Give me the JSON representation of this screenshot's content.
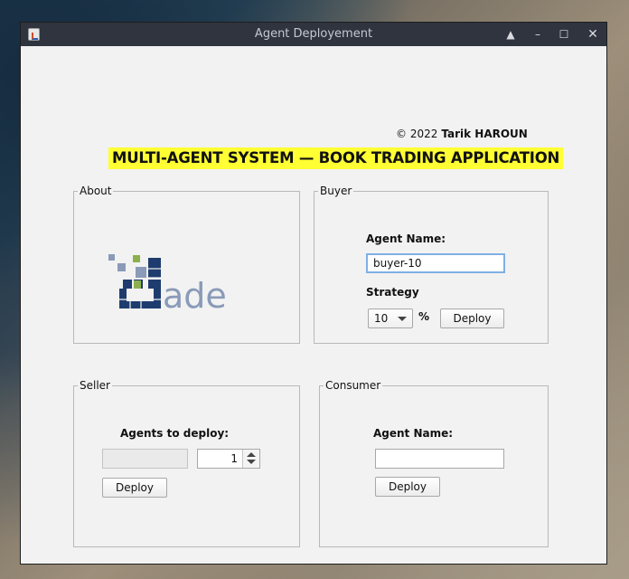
{
  "window": {
    "title": "Agent Deployement"
  },
  "header": {
    "copyright_symbol_year": "© 2022",
    "author": "Tarik HAROUN",
    "headline": "MULTI-AGENT SYSTEM — BOOK TRADING APPLICATION"
  },
  "about": {
    "legend": "About",
    "logo_text": "ade"
  },
  "buyer": {
    "legend": "Buyer",
    "agent_name_label": "Agent Name:",
    "agent_name_value": "buyer-10",
    "strategy_label": "Strategy",
    "strategy_value": "10",
    "percent": "%",
    "deploy_label": "Deploy"
  },
  "seller": {
    "legend": "Seller",
    "agents_label": "Agents to deploy:",
    "count_field_value": "",
    "spinner_value": "1",
    "deploy_label": "Deploy"
  },
  "consumer": {
    "legend": "Consumer",
    "agent_name_label": "Agent Name:",
    "agent_name_value": "",
    "deploy_label": "Deploy"
  },
  "colors": {
    "headline_bg": "#ffff33",
    "logo_navy": "#1f3c6e",
    "logo_green": "#8db04f",
    "logo_grey": "#8a9ab8"
  }
}
